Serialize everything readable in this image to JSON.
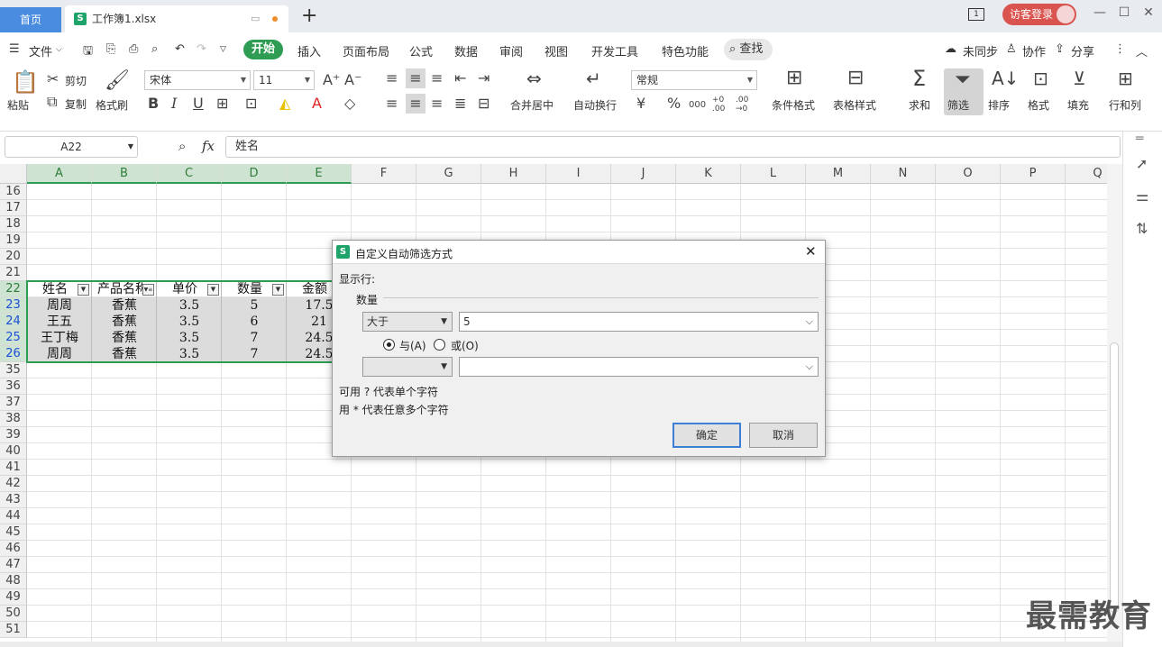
{
  "titlebar": {
    "home_tab": "首页",
    "doc_tab": "工作簿1.xlsx",
    "new_tab": "+",
    "window_count": "1",
    "login": "访客登录"
  },
  "menu": {
    "file": "文件",
    "items": [
      "开始",
      "插入",
      "页面布局",
      "公式",
      "数据",
      "审阅",
      "视图",
      "开发工具",
      "特色功能"
    ],
    "find": "查找",
    "right": [
      "未同步",
      "协作",
      "分享"
    ]
  },
  "ribbon": {
    "paste": "粘贴",
    "cut": "剪切",
    "copy": "复制",
    "format_painter": "格式刷",
    "font_name": "宋体",
    "font_size": "11",
    "bold": "B",
    "italic": "I",
    "underline": "U",
    "merge_center": "合并居中",
    "wrap_text": "自动换行",
    "number_format": "常规",
    "currency": "¥",
    "percent": "%",
    "thousands": "000",
    "inc_decimal": "+0 .00",
    "dec_decimal": ".00 →0",
    "cond_format": "条件格式",
    "table_style": "表格样式",
    "sum": "求和",
    "filter": "筛选",
    "sort": "排序",
    "format": "格式",
    "fill": "填充",
    "rows_cols": "行和列"
  },
  "formula_bar": {
    "name_box": "A22",
    "fx": "fx",
    "content": "姓名"
  },
  "sheet": {
    "columns": [
      "A",
      "B",
      "C",
      "D",
      "E",
      "F",
      "G",
      "H",
      "I",
      "J",
      "K",
      "L",
      "M",
      "N",
      "O",
      "P",
      "Q"
    ],
    "rows": [
      "16",
      "17",
      "18",
      "19",
      "20",
      "21",
      "22",
      "23",
      "24",
      "25",
      "26",
      "35",
      "36",
      "37",
      "38",
      "39",
      "40",
      "41",
      "42",
      "43",
      "44",
      "45",
      "46",
      "47",
      "48",
      "49",
      "50",
      "51"
    ],
    "header": [
      "姓名",
      "产品名称",
      "单价",
      "数量",
      "金额"
    ],
    "data": [
      [
        "周周",
        "香蕉",
        "3.5",
        "5",
        "17.5"
      ],
      [
        "王五",
        "香蕉",
        "3.5",
        "6",
        "21"
      ],
      [
        "王丁梅",
        "香蕉",
        "3.5",
        "7",
        "24.5"
      ],
      [
        "周周",
        "香蕉",
        "3.5",
        "7",
        "24.5"
      ]
    ]
  },
  "dialog": {
    "title": "自定义自动筛选方式",
    "show_rows": "显示行:",
    "field": "数量",
    "op1": "大于",
    "val1": "5",
    "and_label": "与(A)",
    "or_label": "或(O)",
    "op2": "",
    "val2": "",
    "hint1": "可用 ? 代表单个字符",
    "hint2": "用 * 代表任意多个字符",
    "ok": "确定",
    "cancel": "取消"
  },
  "watermark": "最需教育",
  "colors": {
    "accent_green": "#2e9c52",
    "home_blue": "#4a8de0",
    "login_red": "#d9534f"
  }
}
